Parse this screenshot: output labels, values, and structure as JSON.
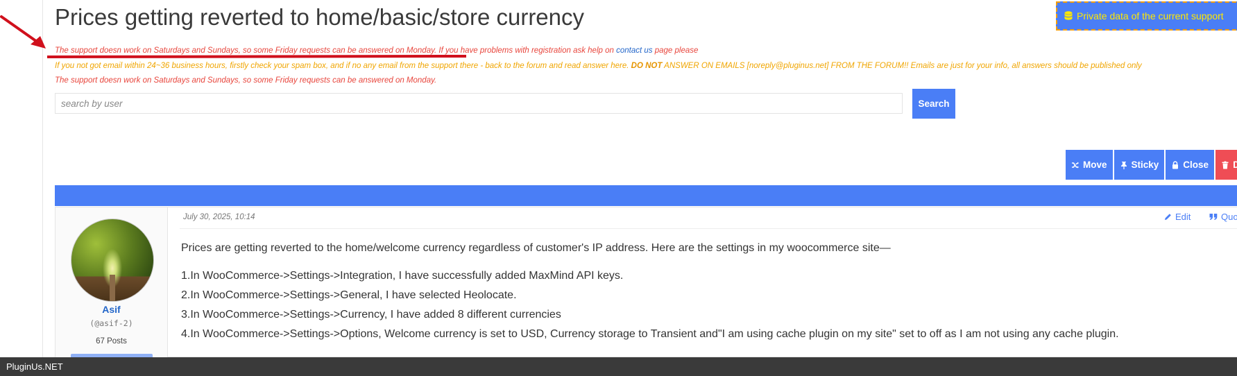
{
  "page": {
    "title": "Prices getting reverted to home/basic/store currency",
    "private_button_label": "Private data of the current support"
  },
  "notices": {
    "line1_main": "The support doesn work on Saturdays and Sundays, so some Friday requests can be answered on Monday",
    "line1_rest": ". If you have problems with registration ask help on ",
    "line1_link": "contact us",
    "line1_tail": " page please",
    "line2_start": "If you not got email within 24~36 business hours, firstly check your spam box, and if no any email from the support there - back to the forum and read answer here. ",
    "line2_bold": "DO NOT",
    "line2_end": " ANSWER ON EMAILS [noreply@pluginus.net] FROM THE FORUM!! Emails are just for your info, all answers should be published only",
    "line3": "The support doesn work on Saturdays and Sundays, so some Friday requests can be answered on Monday."
  },
  "search": {
    "placeholder": "search by user",
    "button_label": "Search"
  },
  "actions": {
    "move": "Move",
    "sticky": "Sticky",
    "close": "Close",
    "delete": "D"
  },
  "post": {
    "date": "July 30, 2025, 10:14",
    "edit_label": "Edit",
    "quote_label": "Quo",
    "author": {
      "name": "Asif",
      "handle": "(@asif-2)",
      "posts": "67 Posts"
    },
    "lead": "Prices are getting reverted to the home/welcome currency regardless of customer's IP address. Here are the settings in my woocommerce site—",
    "items": [
      "1.In WooCommerce->Settings->Integration, I have successfully added MaxMind API keys.",
      "2.In WooCommerce->Settings->General, I have selected Heolocate.",
      "3.In WooCommerce->Settings->Currency, I have added 8 different currencies",
      "4.In WooCommerce->Settings->Options, Welcome currency is set to USD, Currency storage to Transient and\"I am using cache plugin on my site\" set to off as I am not using any cache plugin."
    ]
  },
  "footer": {
    "brand": "PluginUs.NET"
  },
  "colors": {
    "accent": "#4a7ef6",
    "danger": "#ef4d55",
    "notice_red": "#e8453c",
    "notice_orange": "#f0a500",
    "annotation_red": "#d0101c"
  }
}
